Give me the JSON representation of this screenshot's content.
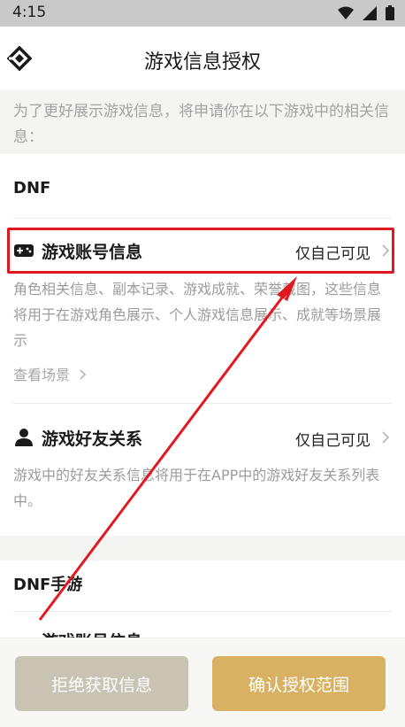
{
  "status_bar": {
    "time": "4:15"
  },
  "header": {
    "title": "游戏信息授权"
  },
  "intro": {
    "text": "为了更好展示游戏信息，将申请你在以下游戏中的相关信息："
  },
  "games": [
    {
      "name": "DNF",
      "items": [
        {
          "title": "游戏账号信息",
          "scope": "仅自己可见",
          "description": "角色相关信息、副本记录、游戏成就、荣誉截图，这些信息将用于在游戏角色展示、个人游戏信息展示、成就等场景展示",
          "link": "查看场景"
        },
        {
          "title": "游戏好友关系",
          "scope": "仅自己可见",
          "description": "游戏中的好友关系信息将用于在APP中的游戏好友关系列表中。"
        }
      ]
    },
    {
      "name": "DNF手游",
      "items": [
        {
          "title": "游戏账号信息"
        }
      ]
    }
  ],
  "buttons": {
    "reject": "拒绝获取信息",
    "confirm": "确认授权范围"
  },
  "colors": {
    "accent": "#d8b163",
    "disabled": "#c8c3b3",
    "annotation": "#e01820"
  },
  "icons": [
    "wifi-icon",
    "signal-icon",
    "battery-icon",
    "app-logo-icon",
    "gamepad-icon",
    "person-icon",
    "chevron-right-icon"
  ]
}
